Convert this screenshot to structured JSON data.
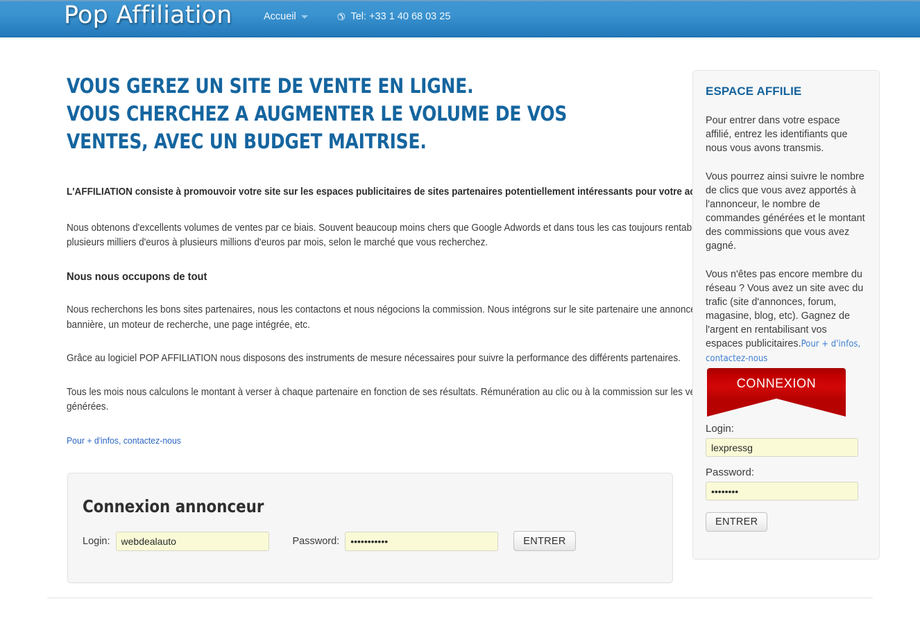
{
  "header": {
    "brand": "Pop Affiliation",
    "nav": {
      "home_label": "Accueil",
      "phone_label": "Tel: +33 1 40 68 03 25"
    },
    "colors": {
      "bg_top": "#3f96d2",
      "bg_bottom": "#2478b9"
    }
  },
  "main": {
    "headline_line1": "VOUS GEREZ UN SITE DE VENTE EN LIGNE.",
    "headline_line2": "VOUS CHERCHEZ A AUGMENTER LE VOLUME DE VOS",
    "headline_line3": "VENTES, AVEC UN BUDGET MAITRISE.",
    "headline_color": "#15659f",
    "lead": "L'AFFILIATION consiste à promouvoir votre site sur les espaces publicitaires de sites partenaires potentiellement intéressants pour votre activité.",
    "para1": "Nous obtenons d'excellents volumes de ventes par ce biais. Souvent beaucoup moins chers que Google Adwords et dans tous les cas toujours rentables. De plusieurs milliers d'euros à plusieurs millions d'euros par mois, selon le marché que vous recherchez.",
    "subheading": "Nous nous occupons de tout",
    "para2": "Nous recherchons les bons sites partenaires, nous les contactons et nous négocions la commission. Nous intégrons sur le site partenaire une annonce, une bannière, un moteur de recherche, une page intégrée, etc.",
    "para3": "Grâce au logiciel POP AFFILIATION nous disposons des instruments de mesure nécessaires pour suivre la performance des différents partenaires.",
    "para4": "Tous les mois nous calculons le montant à verser à chaque partenaire en fonction de ses résultats. Rémunération au clic ou à la commission sur les ventes générées.",
    "contact_link": "Pour + d'infos, contactez-nous",
    "link_color": "#2b66c2"
  },
  "advertiser_login": {
    "title": "Connexion annonceur",
    "login_label": "Login:",
    "login_value": "webdealauto",
    "login_placeholder": "",
    "password_label": "Password:",
    "password_value": "•••••••••••",
    "password_placeholder": "",
    "submit_label": "ENTRER",
    "field_bg": "#fafad7"
  },
  "sidebar": {
    "title": "ESPACE AFFILIE",
    "title_color": "#16639d",
    "para1": "Pour entrer dans votre espace affilié, entrez les identifiants que nous vous avons transmis.",
    "para2": "Vous pourrez ainsi suivre le nombre de clics que vous avez apportés à l'annonceur, le nombre de commandes générées et le montant des commissions que vous avez gagné.",
    "para3": "Vous n'êtes pas encore membre du réseau ? Vous avez un site avec du trafic (site d'annonces, forum, magasine, blog, etc). Gagnez de l'argent en rentabilisant vos espaces publicitaires.",
    "contact_link": "Pour + d'infos, contactez-nous",
    "ribbon_label": "CONNEXION",
    "ribbon_color": "#c40000",
    "login_label": "Login:",
    "login_value": "lexpressg",
    "login_placeholder": "",
    "password_label": "Password:",
    "password_value": "••••••••",
    "password_placeholder": "",
    "submit_label": "ENTRER"
  }
}
